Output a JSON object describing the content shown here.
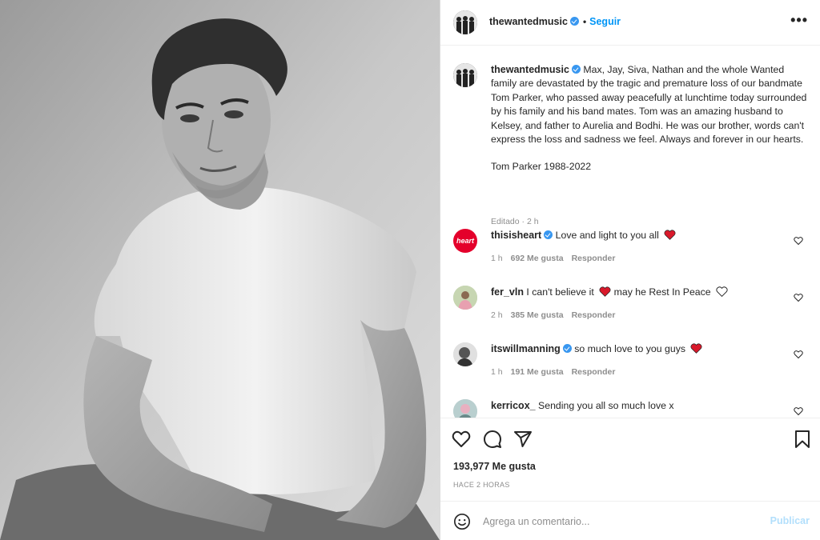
{
  "post": {
    "username": "thewantedmusic",
    "follow_label": "Seguir",
    "more_label": "•••",
    "dot": "•"
  },
  "caption": {
    "username": "thewantedmusic",
    "text": "Max, Jay, Siva, Nathan and the whole Wanted family are devastated by the tragic and premature loss of our bandmate Tom Parker, who passed away peacefully at lunchtime today surrounded by his family and his band mates. Tom was an amazing husband to Kelsey, and father to Aurelia and Bodhi. He was our brother, words can't express the loss and sadness we feel. Always and forever in our hearts.",
    "text2": "Tom Parker 1988-2022",
    "meta": "Editado · 2 h"
  },
  "comments": [
    {
      "username": "thisisheart",
      "verified": true,
      "text": "Love and light to you all",
      "emoji": "red-heart",
      "time": "1 h",
      "likes": "692 Me gusta",
      "reply": "Responder",
      "avatar_text": "heart"
    },
    {
      "username": "fer_vln",
      "verified": false,
      "text": "I can't believe it",
      "text_after": "may he Rest In Peace",
      "emoji": "red-heart",
      "time": "2 h",
      "likes": "385 Me gusta",
      "reply": "Responder"
    },
    {
      "username": "itswillmanning",
      "verified": true,
      "text": "so much love to you guys",
      "emoji": "red-heart",
      "time": "1 h",
      "likes": "191 Me gusta",
      "reply": "Responder"
    },
    {
      "username": "kerricox_",
      "verified": false,
      "text": "Sending you all so much love x"
    }
  ],
  "actions": {
    "likes": "193,977 Me gusta",
    "time_ago": "HACE 2 HORAS"
  },
  "add_comment": {
    "placeholder": "Agrega un comentario...",
    "publish_label": "Publicar"
  },
  "colors": {
    "link_blue": "#0095f6",
    "verified_blue": "#3897f0",
    "heart_red": "#ed4956",
    "muted": "#8e8e8e",
    "publish_disabled": "#b2dffc"
  }
}
